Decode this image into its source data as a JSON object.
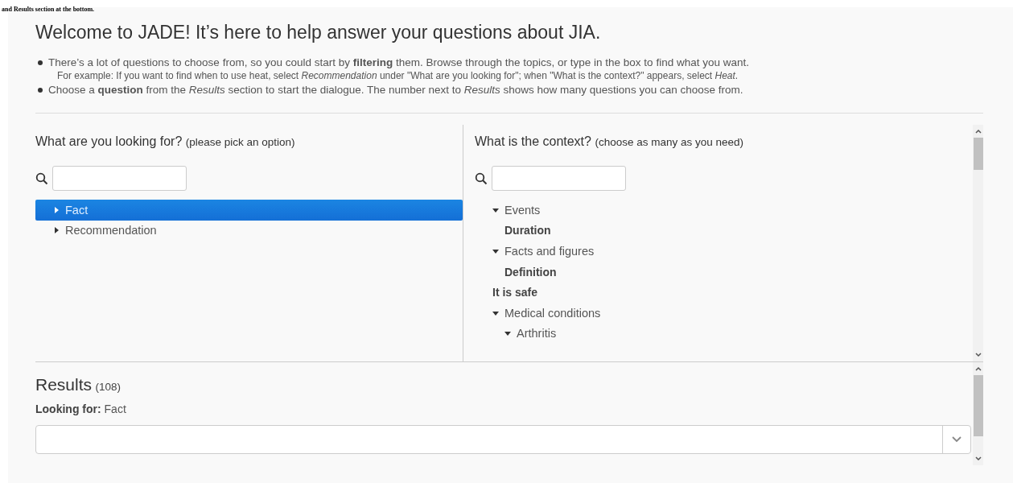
{
  "caption": "and Results section at the bottom.",
  "title": "Welcome to JADE! It’s here to help answer your questions about JIA.",
  "intro": [
    {
      "kind": "bullet",
      "text": "There’s a lot of questions to choose from, so you could start by **filtering** them. Browse through the topics, or type in the box to find what you want."
    },
    {
      "kind": "note",
      "text": "For example: If you want to find when to use heat, select *Recommendation* under \"What are you looking for\"; when \"What is the context?\" appears, select *Heat*."
    },
    {
      "kind": "bullet",
      "text": "Choose a **question** from the *Results* section to start the dialogue. The number next to *Results* shows how many questions you can choose from."
    }
  ],
  "looking_for": {
    "heading": "What are you looking for?",
    "hint": "(please pick an option)",
    "items": [
      {
        "label": "Fact",
        "selected": true,
        "expanded": false
      },
      {
        "label": "Recommendation",
        "selected": false,
        "expanded": false
      }
    ]
  },
  "context": {
    "heading": "What is the context?",
    "hint": "(choose as many as you need)",
    "items": [
      {
        "label": "Events",
        "selected": false,
        "expanded": true,
        "children": [
          {
            "label": "Duration",
            "selected": false
          }
        ]
      },
      {
        "label": "Facts and figures",
        "selected": false,
        "expanded": true,
        "children": [
          {
            "label": "Definition",
            "selected": false
          }
        ]
      },
      {
        "label": "It is safe",
        "selected": false
      },
      {
        "label": "Medical conditions",
        "selected": false,
        "expanded": true,
        "children": [
          {
            "label": "Arthritis",
            "selected": false,
            "expanded": true
          }
        ]
      }
    ]
  },
  "results": {
    "heading": "Results",
    "count": "(108)",
    "filter_label": "Looking for:",
    "filter_value": "Fact"
  }
}
